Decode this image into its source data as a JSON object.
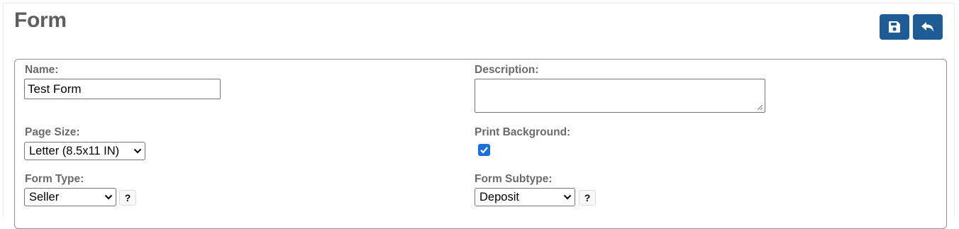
{
  "header": {
    "title": "Form",
    "save_icon": "save-icon",
    "undo_icon": "undo-icon",
    "button_color": "#1f5c96"
  },
  "form": {
    "name": {
      "label": "Name:",
      "value": "Test Form"
    },
    "description": {
      "label": "Description:",
      "value": ""
    },
    "page_size": {
      "label": "Page Size:",
      "selected": "Letter (8.5x11 IN)"
    },
    "print_background": {
      "label": "Print Background:",
      "checked": true
    },
    "form_type": {
      "label": "Form Type:",
      "selected": "Seller",
      "help": "?"
    },
    "form_subtype": {
      "label": "Form Subtype:",
      "selected": "Deposit",
      "help": "?"
    }
  }
}
